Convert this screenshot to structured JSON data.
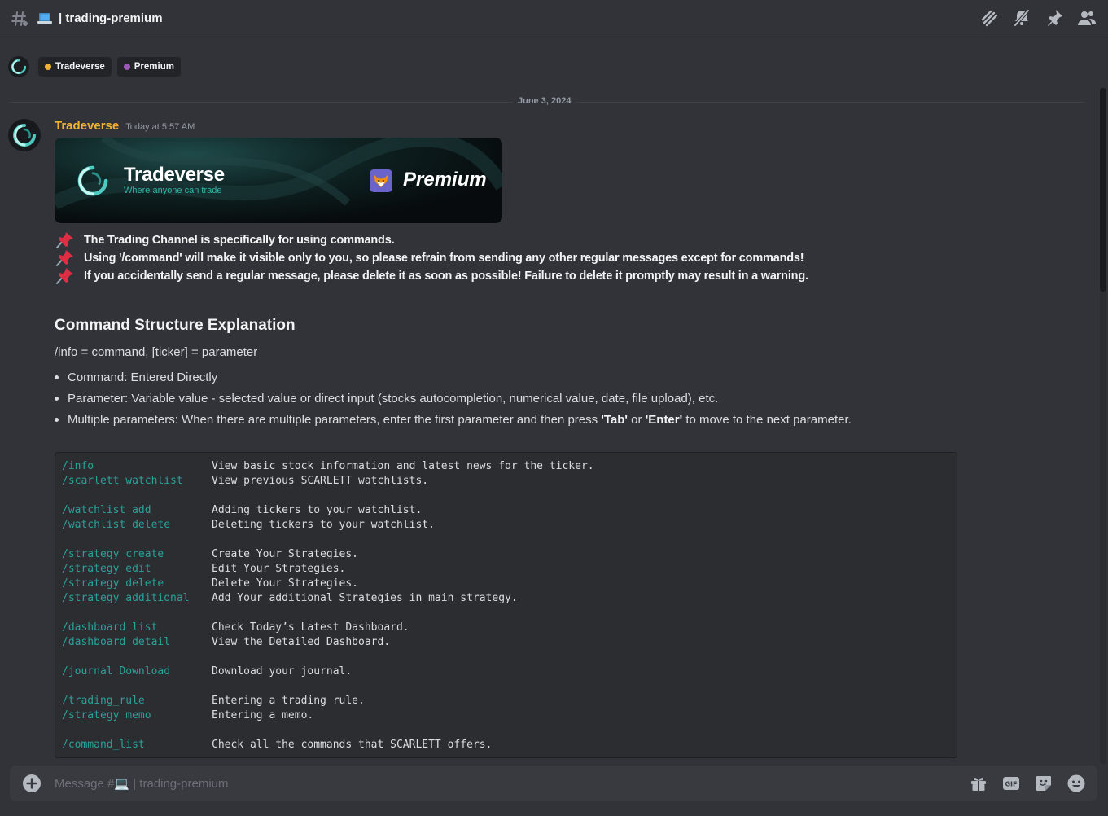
{
  "header": {
    "title": "| trading-premium",
    "icons": [
      "threads-icon",
      "notifications-muted-icon",
      "pinned-messages-icon",
      "member-list-icon"
    ]
  },
  "roles": [
    {
      "name": "Tradeverse",
      "color": "#f0b232"
    },
    {
      "name": "Premium",
      "color": "#9b59b6"
    }
  ],
  "divider_date": "June 3, 2024",
  "message": {
    "author": "Tradeverse",
    "author_color": "#f0b232",
    "timestamp": "Today at 5:57 AM",
    "banner": {
      "brand": "Tradeverse",
      "tagline": "Where anyone can trade",
      "label": "Premium"
    },
    "rules": [
      "The Trading Channel is specifically for using commands.",
      "Using '/command' will make it visible only to you, so please refrain from sending any other regular messages except for commands!",
      "If you accidentally send a regular message, please delete it as soon as possible! Failure to delete it promptly may result in a warning."
    ],
    "section_title": "Command Structure Explanation",
    "info_line": "/info = command, [ticker] = parameter",
    "bullets": {
      "b1": "Command: Entered Directly",
      "b2": "Parameter: Variable value - selected value or direct input (stocks autocompletion, numerical value, date, file upload), etc.",
      "b3_pre": "Multiple parameters: When there are multiple parameters, enter the first parameter and then press ",
      "b3_tab": "'Tab'",
      "b3_or": " or ",
      "b3_enter": "'Enter'",
      "b3_post": " to move to the next parameter."
    },
    "commands": [
      {
        "cmd": "/info",
        "desc": "View basic stock information and latest news for the ticker."
      },
      {
        "cmd": "/scarlett watchlist",
        "desc": "View previous SCARLETT watchlists."
      },
      {
        "cmd": "/watchlist add",
        "desc": "Adding tickers to your watchlist."
      },
      {
        "cmd": "/watchlist delete",
        "desc": "Deleting tickers to your watchlist."
      },
      {
        "cmd": "/strategy create",
        "desc": "Create Your Strategies."
      },
      {
        "cmd": "/strategy edit",
        "desc": "Edit Your Strategies."
      },
      {
        "cmd": "/strategy delete",
        "desc": "Delete Your Strategies."
      },
      {
        "cmd": "/strategy additional",
        "desc": "Add Your additional Strategies in main strategy."
      },
      {
        "cmd": "/dashboard list",
        "desc": "Check Today’s Latest Dashboard."
      },
      {
        "cmd": "/dashboard detail",
        "desc": "View the Detailed Dashboard."
      },
      {
        "cmd": "/journal Download",
        "desc": "Download your journal."
      },
      {
        "cmd": "/trading_rule",
        "desc": "Entering a trading rule."
      },
      {
        "cmd": "/strategy memo",
        "desc": "Entering a memo."
      },
      {
        "cmd": "/command_list",
        "desc": "Check all the commands that SCARLETT offers."
      }
    ]
  },
  "composer": {
    "placeholder": "Message #💻 | trading-premium",
    "icons": [
      "gift-icon",
      "gif-icon",
      "sticker-icon",
      "emoji-icon"
    ]
  }
}
